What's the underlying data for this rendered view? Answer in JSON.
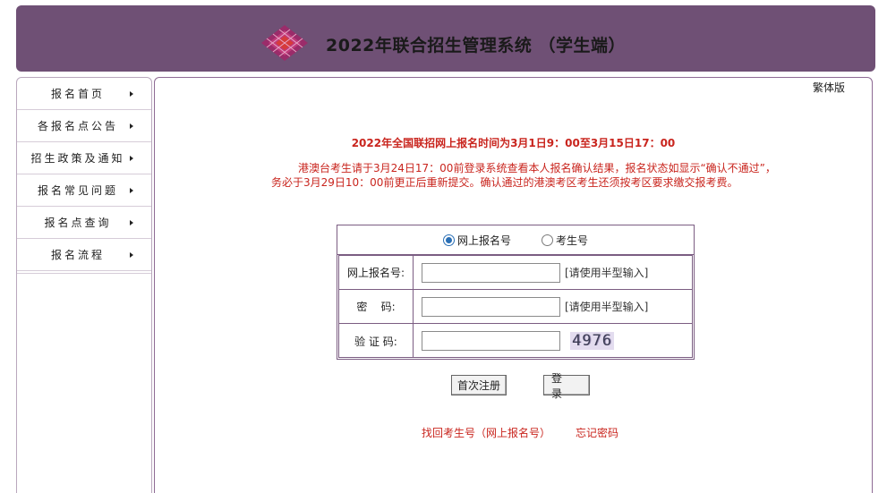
{
  "header": {
    "title": "2022年联合招生管理系统 （学生端）",
    "logo": "diamond-logo-icon",
    "colors": {
      "bar": "#6f5075",
      "logo_outer": "#9b2c6a",
      "logo_inner": "#d63b3b"
    }
  },
  "sidebar": {
    "items": [
      {
        "label": "报名首页"
      },
      {
        "label": "各报名点公告"
      },
      {
        "label": "招生政策及通知"
      },
      {
        "label": "报名常见问题"
      },
      {
        "label": "报名点查询"
      },
      {
        "label": "报名流程"
      }
    ]
  },
  "main": {
    "lang_switch": "繁体版",
    "notice": {
      "title": "2022年全国联招网上报名时间为3月1日9：00至3月15日17：00",
      "line1": "港澳台考生请于3月24日17：00前登录系统查看本人报名确认结果，报名状态如显示“确认不通过”，",
      "line2": "务必于3月29日10：00前更正后重新提交。确认通过的港澳考区考生还须按考区要求缴交报考费。",
      "color": "#c9251e"
    },
    "login": {
      "radio_options": [
        "网上报名号",
        "考生号"
      ],
      "selected": "网上报名号",
      "fields": {
        "online_no": {
          "label": "网上报名号:",
          "value": "",
          "hint": "[请使用半型输入]"
        },
        "password": {
          "label": "密    码:",
          "value": "",
          "hint": "[请使用半型输入]"
        },
        "captcha": {
          "label": "验 证 码:",
          "value": "",
          "code": "4976"
        }
      },
      "buttons": {
        "register": "首次注册",
        "login": "登 录"
      }
    },
    "links": {
      "recover": "找回考生号（网上报名号）",
      "forgot": "忘记密码"
    }
  }
}
